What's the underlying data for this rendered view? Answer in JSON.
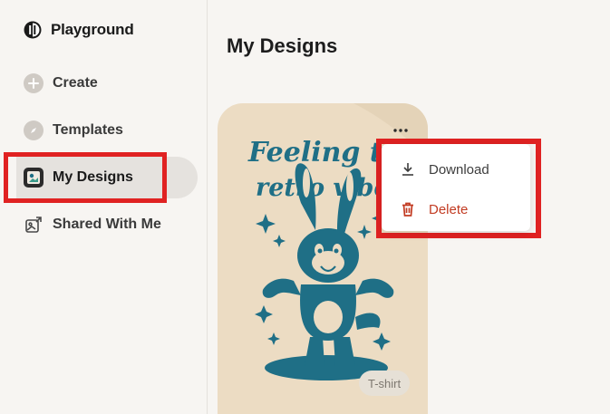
{
  "app": {
    "name": "Playground"
  },
  "sidebar": {
    "items": [
      {
        "label": "Create",
        "icon": "plus-icon"
      },
      {
        "label": "Templates",
        "icon": "compass-icon"
      },
      {
        "label": "My Designs",
        "icon": "design-thumbnail-icon",
        "active": true
      },
      {
        "label": "Shared With Me",
        "icon": "shared-image-icon"
      }
    ]
  },
  "main": {
    "title": "My Designs",
    "card": {
      "art_text_line1": "Feeling the",
      "art_text_line2": "retro vibes",
      "tag": "T-shirt"
    },
    "menu": {
      "items": [
        {
          "label": "Download",
          "icon": "download-icon"
        },
        {
          "label": "Delete",
          "icon": "trash-icon"
        }
      ]
    }
  },
  "colors": {
    "accent_red": "#e02222",
    "delete_red": "#c23b22",
    "art_teal": "#1f6f86",
    "card_bg": "#ecdcc3"
  }
}
